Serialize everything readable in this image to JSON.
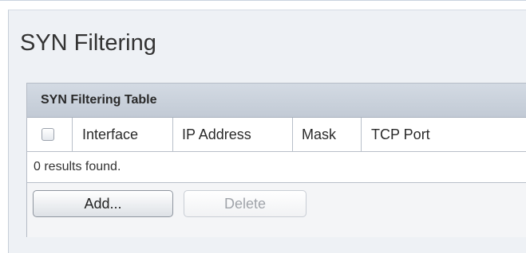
{
  "page": {
    "title": "SYN Filtering"
  },
  "table": {
    "title": "SYN Filtering Table",
    "columns": [
      "Interface",
      "IP Address",
      "Mask",
      "TCP Port"
    ],
    "select_all_checked": false,
    "results_text": "0 results found."
  },
  "buttons": {
    "add_label": "Add...",
    "delete_label": "Delete",
    "delete_enabled": false
  },
  "colors": {
    "panel_background": "#eef1f5",
    "table_title_bar": "#c8cfd9",
    "disabled_text": "#a0a4aa"
  }
}
